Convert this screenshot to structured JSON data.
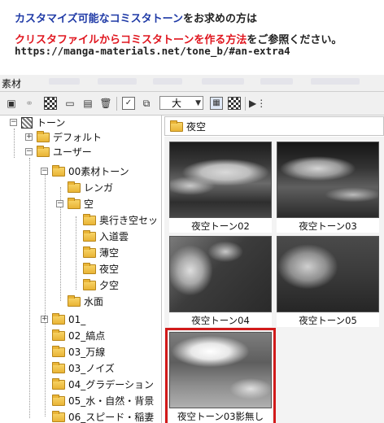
{
  "header": {
    "line1_highlight": "カスタマイズ可能なコミスタトーン",
    "line1_rest": "をお求めの方は",
    "line2_highlight": "クリスタファイルからコミスタトーンを作る方法",
    "line2_rest": "をご参照ください。",
    "line3": "https://manga-materials.net/tone_b/#an-extra4"
  },
  "window": {
    "title": "素材"
  },
  "toolbar": {
    "size_value": "大"
  },
  "tree": {
    "items": [
      {
        "label": "トーン",
        "toggle": "−"
      },
      {
        "label": "デフォルト",
        "toggle": "+"
      },
      {
        "label": "ユーザー",
        "toggle": "−"
      },
      {
        "label": "00素材トーン",
        "toggle": "−"
      },
      {
        "label": "レンガ",
        "toggle": ""
      },
      {
        "label": "空",
        "toggle": "−"
      },
      {
        "label": "奥行き空セッ",
        "toggle": ""
      },
      {
        "label": "入道雲",
        "toggle": ""
      },
      {
        "label": "薄空",
        "toggle": ""
      },
      {
        "label": "夜空",
        "toggle": ""
      },
      {
        "label": "夕空",
        "toggle": ""
      },
      {
        "label": "水面",
        "toggle": ""
      },
      {
        "label": "01_",
        "toggle": "+"
      },
      {
        "label": "02_縞点",
        "toggle": ""
      },
      {
        "label": "03_万線",
        "toggle": ""
      },
      {
        "label": "03_ノイズ",
        "toggle": ""
      },
      {
        "label": "04_グラデーション",
        "toggle": ""
      },
      {
        "label": "05_水・自然・背景",
        "toggle": ""
      },
      {
        "label": "06_スピード・稲妻",
        "toggle": ""
      }
    ]
  },
  "path": {
    "label": "夜空"
  },
  "thumbs": [
    {
      "caption": "夜空トーン02"
    },
    {
      "caption": "夜空トーン03"
    },
    {
      "caption": "夜空トーン04"
    },
    {
      "caption": "夜空トーン05"
    },
    {
      "caption": "夜空トーン03影無し"
    }
  ],
  "colors": {
    "highlight_blue": "#1f3aa6",
    "highlight_red": "#e0161f",
    "selection_border": "#d11a1a"
  }
}
